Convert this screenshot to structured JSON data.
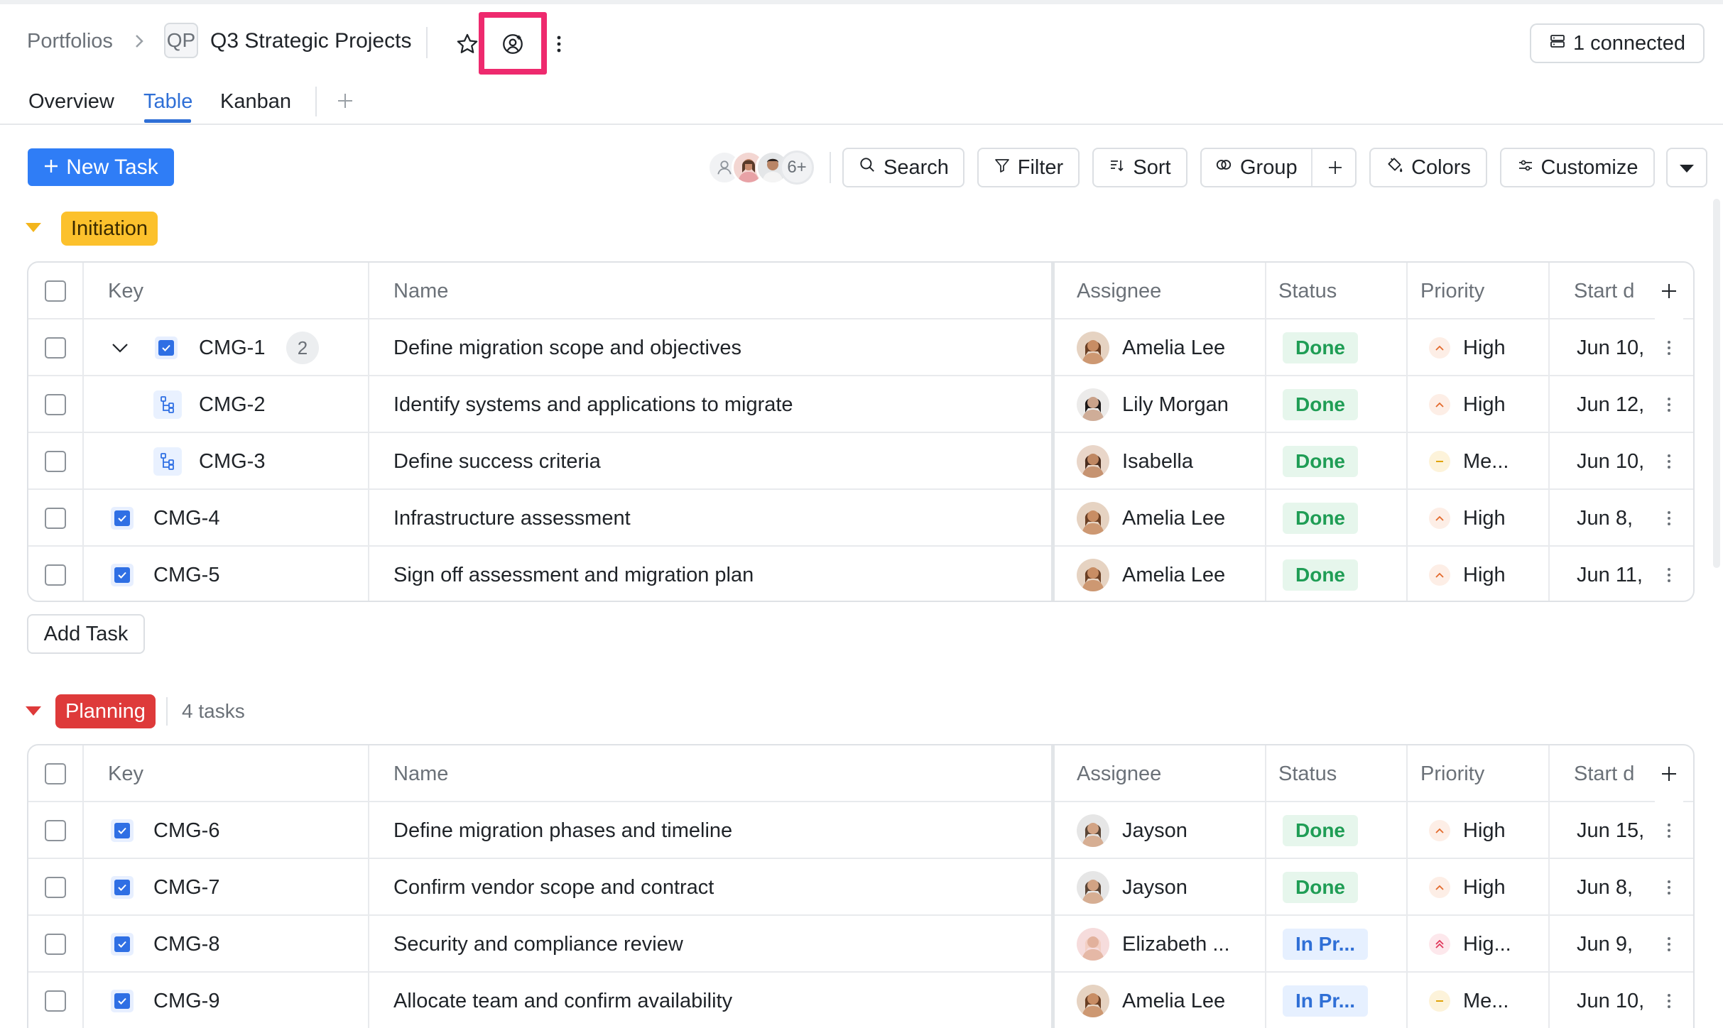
{
  "breadcrumb": {
    "portfolios": "Portfolios",
    "project_badge": "QP",
    "project_title": "Q3 Strategic Projects"
  },
  "header": {
    "connected_label": "1 connected"
  },
  "tabs": [
    {
      "label": "Overview"
    },
    {
      "label": "Table"
    },
    {
      "label": "Kanban"
    }
  ],
  "active_tab": "Table",
  "toolbar": {
    "new_task": "New Task",
    "avatars_more": "6+",
    "search": "Search",
    "filter": "Filter",
    "sort": "Sort",
    "group": "Group",
    "colors": "Colors",
    "customize": "Customize"
  },
  "columns": {
    "key": "Key",
    "name": "Name",
    "assignee": "Assignee",
    "status": "Status",
    "priority": "Priority",
    "start": "Start d"
  },
  "groups": [
    {
      "label": "Initiation",
      "color": "#fcc12c",
      "rows": [
        {
          "key": "CMG-1",
          "name": "Define migration scope and objectives",
          "assignee": "Amelia Lee",
          "status": "Done",
          "priority": "High",
          "start": "Jun 10,",
          "subcount": "2"
        },
        {
          "key": "CMG-2",
          "name": "Identify systems and applications to migrate",
          "assignee": "Lily Morgan",
          "status": "Done",
          "priority": "High",
          "start": "Jun 12,"
        },
        {
          "key": "CMG-3",
          "name": "Define success criteria",
          "assignee": "Isabella",
          "status": "Done",
          "priority": "Me...",
          "start": "Jun 10,"
        },
        {
          "key": "CMG-4",
          "name": "Infrastructure assessment",
          "assignee": "Amelia Lee",
          "status": "Done",
          "priority": "High",
          "start": "Jun 8,"
        },
        {
          "key": "CMG-5",
          "name": "Sign off assessment and migration plan",
          "assignee": "Amelia Lee",
          "status": "Done",
          "priority": "High",
          "start": "Jun 11,"
        }
      ],
      "add_task": "Add Task"
    },
    {
      "label": "Planning",
      "color": "#de3a3a",
      "count": "4 tasks",
      "rows": [
        {
          "key": "CMG-6",
          "name": "Define migration phases and timeline",
          "assignee": "Jayson",
          "status": "Done",
          "priority": "High",
          "start": "Jun 15,"
        },
        {
          "key": "CMG-7",
          "name": "Confirm vendor scope and contract",
          "assignee": "Jayson",
          "status": "Done",
          "priority": "High",
          "start": "Jun 8,"
        },
        {
          "key": "CMG-8",
          "name": "Security and compliance review",
          "assignee": "Elizabeth ...",
          "status": "In Pr...",
          "priority": "Hig...",
          "start": "Jun 9,"
        },
        {
          "key": "CMG-9",
          "name": "Allocate team and confirm availability",
          "assignee": "Amelia Lee",
          "status": "In Pr...",
          "priority": "Me...",
          "start": "Jun 10,"
        }
      ]
    }
  ]
}
